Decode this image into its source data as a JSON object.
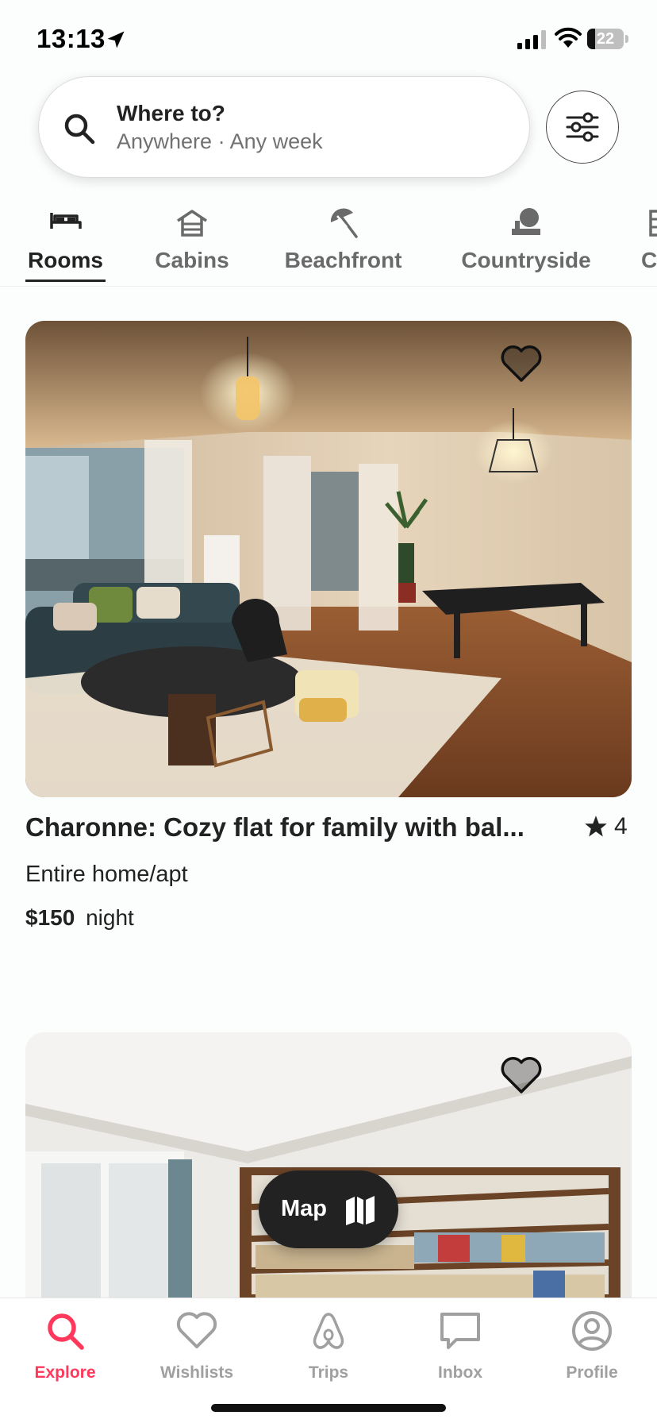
{
  "status_bar": {
    "time": "13:13",
    "battery_level": "22",
    "battery_fraction": 0.22
  },
  "search": {
    "title": "Where to?",
    "subtitle": "Anywhere · Any week"
  },
  "categories": [
    {
      "label": "Rooms",
      "icon": "bed-icon",
      "active": true
    },
    {
      "label": "Cabins",
      "icon": "cabin-icon",
      "active": false
    },
    {
      "label": "Beachfront",
      "icon": "beach-umbrella-icon",
      "active": false
    },
    {
      "label": "Countryside",
      "icon": "countryside-tree-icon",
      "active": false
    },
    {
      "label": "C",
      "icon": "partial-category-icon",
      "active": false
    }
  ],
  "listings": [
    {
      "title": "Charonne: Cozy flat for family with bal...",
      "rating": "4",
      "type": "Entire home/apt",
      "price": "$150",
      "price_unit": "night"
    }
  ],
  "map_button": {
    "label": "Map",
    "icon": "map-icon"
  },
  "tabs": [
    {
      "label": "Explore",
      "icon": "search-icon",
      "active": true
    },
    {
      "label": "Wishlists",
      "icon": "heart-icon",
      "active": false
    },
    {
      "label": "Trips",
      "icon": "airbnb-logo-icon",
      "active": false
    },
    {
      "label": "Inbox",
      "icon": "message-icon",
      "active": false
    },
    {
      "label": "Profile",
      "icon": "profile-icon",
      "active": false
    }
  ],
  "colors": {
    "accent": "#ff385c",
    "text": "#222222",
    "muted": "#717171"
  }
}
